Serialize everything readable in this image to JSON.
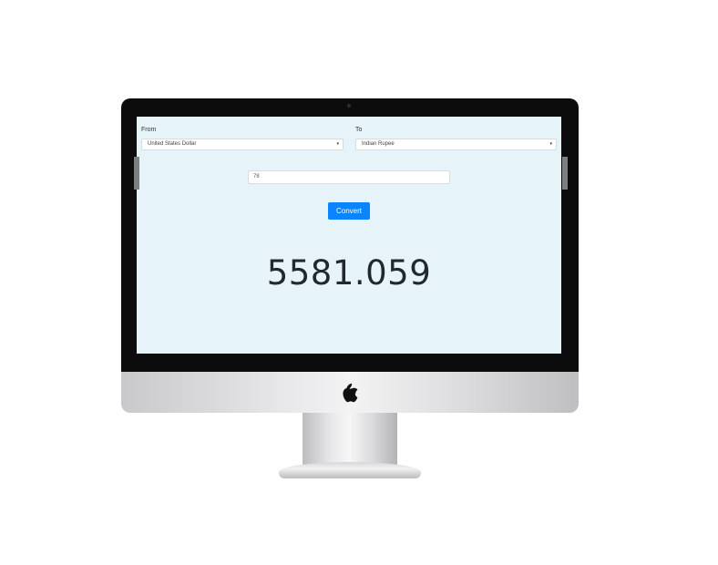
{
  "converter": {
    "from_label": "From",
    "from_value": "United States Dollar",
    "to_label": "To",
    "to_value": "Indian Rupee",
    "amount_value": "78",
    "convert_label": "Convert",
    "result": "5581.059"
  },
  "icons": {
    "select_caret": "▾",
    "logo": "apple-logo-icon"
  },
  "colors": {
    "screen_background": "#e6f4f9",
    "button": "#0a84ff",
    "result_text": "#222831"
  }
}
